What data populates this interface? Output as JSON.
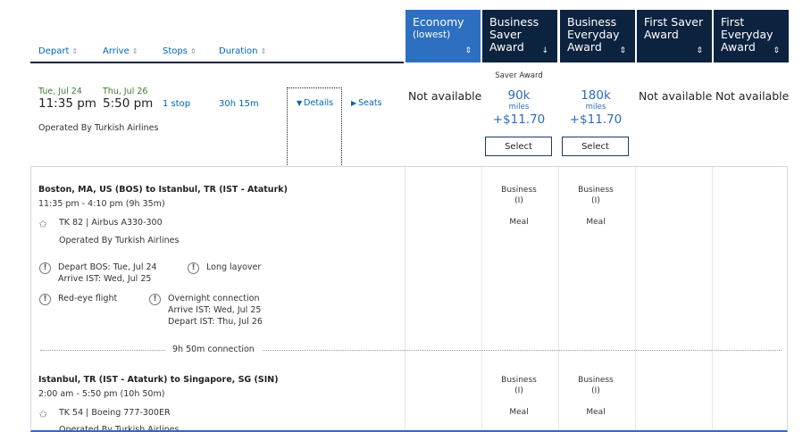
{
  "sort": {
    "depart": "Depart",
    "arrive": "Arrive",
    "stops": "Stops",
    "duration": "Duration",
    "arrow": "⇕"
  },
  "cabins": [
    {
      "title": "Economy",
      "sub": "(lowest)",
      "caret": "⇕"
    },
    {
      "title": "Business Saver Award",
      "caret": "↓"
    },
    {
      "title": "Business Everyday Award",
      "caret": "⇕"
    },
    {
      "title": "First Saver Award",
      "caret": "⇕"
    },
    {
      "title": "First Everyday Award",
      "caret": "⇕"
    }
  ],
  "flight": {
    "depart_date": "Tue, Jul 24",
    "depart_time": "11:35 pm",
    "arrive_date": "Thu, Jul 26",
    "arrive_time": "5:50 pm",
    "stops": "1 stop",
    "duration": "30h 15m",
    "details": "Details",
    "seats": "Seats",
    "operated_by": "Operated By Turkish Airlines"
  },
  "fares": {
    "not_available": "Not available",
    "saver_label": "Saver Award",
    "saver_miles": "90k",
    "everyday_miles": "180k",
    "miles_unit": "miles",
    "fee": "+$11.70",
    "select": "Select"
  },
  "segments": [
    {
      "route": "Boston, MA, US (BOS) to Istanbul, TR (IST - Ataturk)",
      "times": "11:35 pm - 4:10 pm (9h 35m)",
      "flight": "TK 82 | Airbus A330-300",
      "operated": "Operated By Turkish Airlines",
      "cabin": "Business",
      "code": "(I)",
      "meal": "Meal"
    },
    {
      "route": "Istanbul, TR (IST - Ataturk) to Singapore, SG (SIN)",
      "times": "2:00 am - 5:50 pm (10h 50m)",
      "flight": "TK 54 | Boeing 777-300ER",
      "operated": "Operated By Turkish Airlines",
      "cabin": "Business",
      "code": "(I)",
      "meal": "Meal"
    }
  ],
  "notes": {
    "depart": "Depart BOS: Tue, Jul 24",
    "arrive": "Arrive IST: Wed, Jul 25",
    "long_layover": "Long layover",
    "red_eye": "Red-eye flight",
    "overnight": "Overnight connection",
    "overnight_arrive": "Arrive IST: Wed, Jul 25",
    "overnight_depart": "Depart IST: Thu, Jul 26"
  },
  "connection": "9h 50m connection",
  "icons": {
    "warning": "!",
    "star": "✩",
    "triangle_down": "▼",
    "triangle_right": "▶"
  }
}
